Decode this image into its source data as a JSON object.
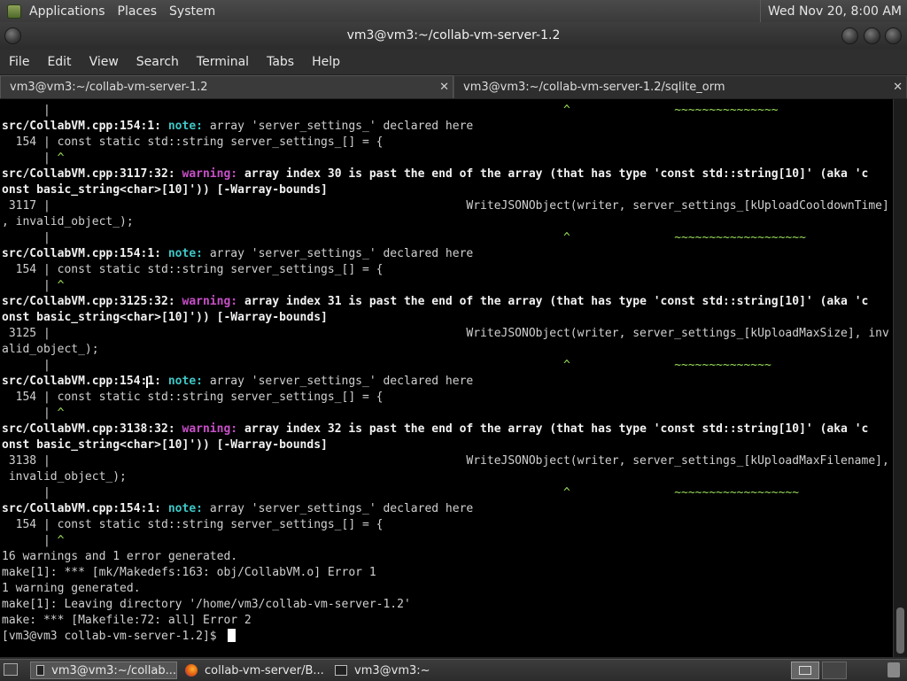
{
  "top_panel": {
    "menus": [
      "Applications",
      "Places",
      "System"
    ],
    "clock": "Wed Nov 20,  8:00 AM"
  },
  "window": {
    "title": "vm3@vm3:~/collab-vm-server-1.2"
  },
  "menubar": [
    "File",
    "Edit",
    "View",
    "Search",
    "Terminal",
    "Tabs",
    "Help"
  ],
  "tabs": [
    {
      "label": "vm3@vm3:~/collab-vm-server-1.2",
      "active": true
    },
    {
      "label": "vm3@vm3:~/collab-vm-server-1.2/sqlite_orm",
      "active": false
    }
  ],
  "terminal": {
    "lines": [
      {
        "segs": [
          {
            "t": "      |                                                                          "
          },
          {
            "t": "^",
            "c": "caret"
          },
          {
            "t": "               "
          },
          {
            "t": "~~~~~~~~~~~~~~~",
            "c": "tilde"
          }
        ]
      },
      {
        "segs": [
          {
            "t": "src/CollabVM.cpp:154:1: ",
            "c": "b"
          },
          {
            "t": "note: ",
            "c": "note"
          },
          {
            "t": "array 'server_settings_' declared here"
          }
        ]
      },
      {
        "segs": [
          {
            "t": "  154 | const static std::string server_settings_[] = {"
          }
        ]
      },
      {
        "segs": [
          {
            "t": "      | "
          },
          {
            "t": "^",
            "c": "caret"
          }
        ]
      },
      {
        "segs": [
          {
            "t": "src/CollabVM.cpp:3117:32: ",
            "c": "b"
          },
          {
            "t": "warning: ",
            "c": "warn"
          },
          {
            "t": "array index 30 is past the end of the array (that has type 'const std::string[10]' (aka 'c",
            "c": "b"
          }
        ]
      },
      {
        "segs": [
          {
            "t": "onst basic_string<char>[10]')) [-Warray-bounds]",
            "c": "b"
          }
        ]
      },
      {
        "segs": [
          {
            "t": " 3117 |                                                            WriteJSONObject(writer, server_settings_[kUploadCooldownTime]"
          }
        ]
      },
      {
        "segs": [
          {
            "t": ", invalid_object_);"
          }
        ]
      },
      {
        "segs": [
          {
            "t": "      |                                                                          "
          },
          {
            "t": "^",
            "c": "caret"
          },
          {
            "t": "               "
          },
          {
            "t": "~~~~~~~~~~~~~~~~~~~",
            "c": "tilde"
          }
        ]
      },
      {
        "segs": [
          {
            "t": "src/CollabVM.cpp:154:1: ",
            "c": "b"
          },
          {
            "t": "note: ",
            "c": "note"
          },
          {
            "t": "array 'server_settings_' declared here"
          }
        ]
      },
      {
        "segs": [
          {
            "t": "  154 | const static std::string server_settings_[] = {"
          }
        ]
      },
      {
        "segs": [
          {
            "t": "      | "
          },
          {
            "t": "^",
            "c": "caret"
          }
        ]
      },
      {
        "segs": [
          {
            "t": "src/CollabVM.cpp:3125:32: ",
            "c": "b"
          },
          {
            "t": "warning: ",
            "c": "warn"
          },
          {
            "t": "array index 31 is past the end of the array (that has type 'const std::string[10]' (aka 'c",
            "c": "b"
          }
        ]
      },
      {
        "segs": [
          {
            "t": "onst basic_string<char>[10]')) [-Warray-bounds]",
            "c": "b"
          }
        ]
      },
      {
        "segs": [
          {
            "t": " 3125 |                                                            WriteJSONObject(writer, server_settings_[kUploadMaxSize], inv"
          }
        ]
      },
      {
        "segs": [
          {
            "t": "alid_object_);"
          }
        ]
      },
      {
        "segs": [
          {
            "t": "      |                                                                          "
          },
          {
            "t": "^",
            "c": "caret"
          },
          {
            "t": "               "
          },
          {
            "t": "~~~~~~~~~~~~~~",
            "c": "tilde"
          }
        ]
      },
      {
        "segs": [
          {
            "t": "src/CollabVM.cpp:154:1: ",
            "c": "b"
          },
          {
            "t": "note: ",
            "c": "note"
          },
          {
            "t": "array 'server_settings_' declared here"
          }
        ]
      },
      {
        "segs": [
          {
            "t": "  154 | const static std::string server_settings_[] = {"
          }
        ]
      },
      {
        "segs": [
          {
            "t": "      | "
          },
          {
            "t": "^",
            "c": "caret"
          }
        ]
      },
      {
        "segs": [
          {
            "t": "src/CollabVM.cpp:3138:32: ",
            "c": "b"
          },
          {
            "t": "warning: ",
            "c": "warn"
          },
          {
            "t": "array index 32 is past the end of the array (that has type 'const std::string[10]' (aka 'c",
            "c": "b"
          }
        ]
      },
      {
        "segs": [
          {
            "t": "onst basic_string<char>[10]')) [-Warray-bounds]",
            "c": "b"
          }
        ]
      },
      {
        "segs": [
          {
            "t": " 3138 |                                                            WriteJSONObject(writer, server_settings_[kUploadMaxFilename],"
          }
        ]
      },
      {
        "segs": [
          {
            "t": " invalid_object_);"
          }
        ]
      },
      {
        "segs": [
          {
            "t": "      |                                                                          "
          },
          {
            "t": "^",
            "c": "caret"
          },
          {
            "t": "               "
          },
          {
            "t": "~~~~~~~~~~~~~~~~~~",
            "c": "tilde"
          }
        ]
      },
      {
        "segs": [
          {
            "t": "src/CollabVM.cpp:154:1: ",
            "c": "b"
          },
          {
            "t": "note: ",
            "c": "note"
          },
          {
            "t": "array 'server_settings_' declared here"
          }
        ]
      },
      {
        "segs": [
          {
            "t": "  154 | const static std::string server_settings_[] = {"
          }
        ]
      },
      {
        "segs": [
          {
            "t": "      | "
          },
          {
            "t": "^",
            "c": "caret"
          }
        ]
      },
      {
        "segs": [
          {
            "t": "16 warnings and 1 error generated."
          }
        ]
      },
      {
        "segs": [
          {
            "t": "make[1]: *** [mk/Makedefs:163: obj/CollabVM.o] Error 1"
          }
        ]
      },
      {
        "segs": [
          {
            "t": "1 warning generated."
          }
        ]
      },
      {
        "segs": [
          {
            "t": "make[1]: Leaving directory '/home/vm3/collab-vm-server-1.2'"
          }
        ]
      },
      {
        "segs": [
          {
            "t": "make: *** [Makefile:72: all] Error 2"
          }
        ]
      },
      {
        "segs": [
          {
            "t": "[vm3@vm3 collab-vm-server-1.2]$ "
          }
        ]
      }
    ]
  },
  "taskbar": {
    "items": [
      {
        "label": "vm3@vm3:~/collab...",
        "icon": "terminal-icon",
        "active": true
      },
      {
        "label": "collab-vm-server/B...",
        "icon": "firefox-icon",
        "active": false
      },
      {
        "label": "vm3@vm3:~",
        "icon": "terminal-icon",
        "active": false
      }
    ]
  }
}
